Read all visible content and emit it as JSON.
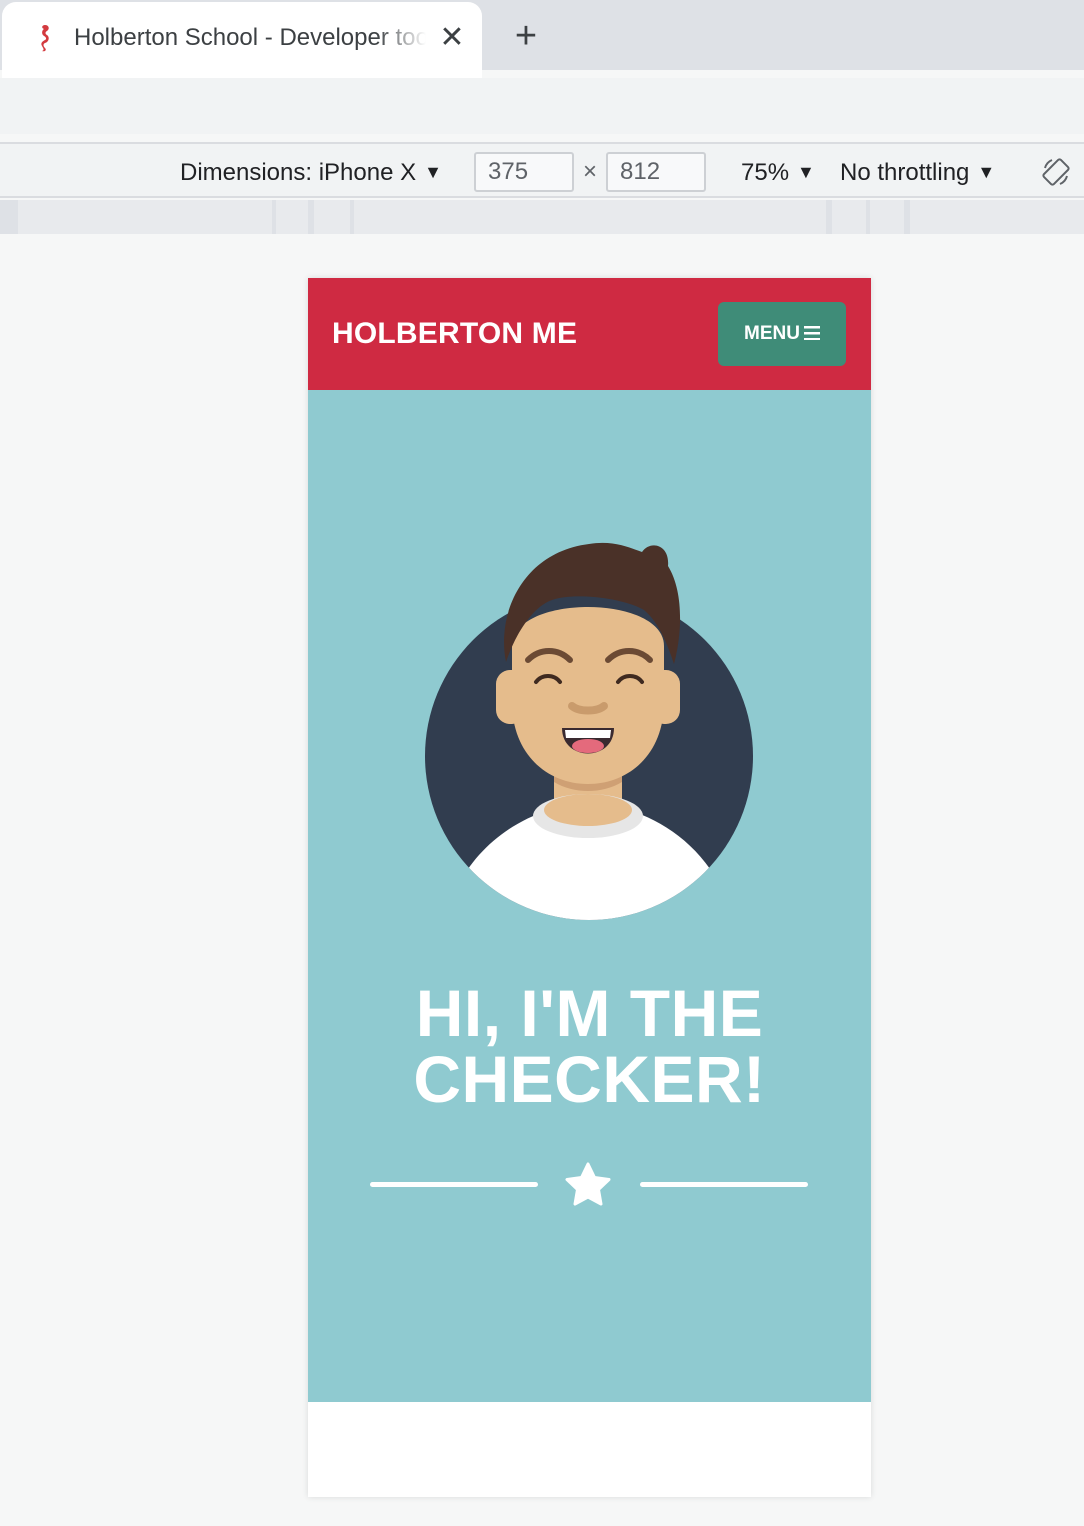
{
  "browser": {
    "tab_title": "Holberton School - Developer tools",
    "close_glyph": "✕",
    "new_tab_glyph": "+",
    "favicon": "seahorse-icon"
  },
  "devtools": {
    "dimensions_label": "Dimensions: iPhone X",
    "width_value": "375",
    "times_glyph": "×",
    "height_value": "812",
    "zoom": "75%",
    "throttling": "No throttling",
    "dropdown_glyph": "▼",
    "rotate_icon": "rotate-icon"
  },
  "site": {
    "brand": "HOLBERTON ME",
    "menu_label": "MENU",
    "hero_title": "HI, I'M THE CHECKER!",
    "avatar": "smiling-person-avatar",
    "divider_icon": "star-icon"
  },
  "colors": {
    "header_red": "#cf2a42",
    "menu_green": "#3f8c78",
    "hero_teal": "#8fcad0",
    "avatar_circle": "#313d4f"
  }
}
